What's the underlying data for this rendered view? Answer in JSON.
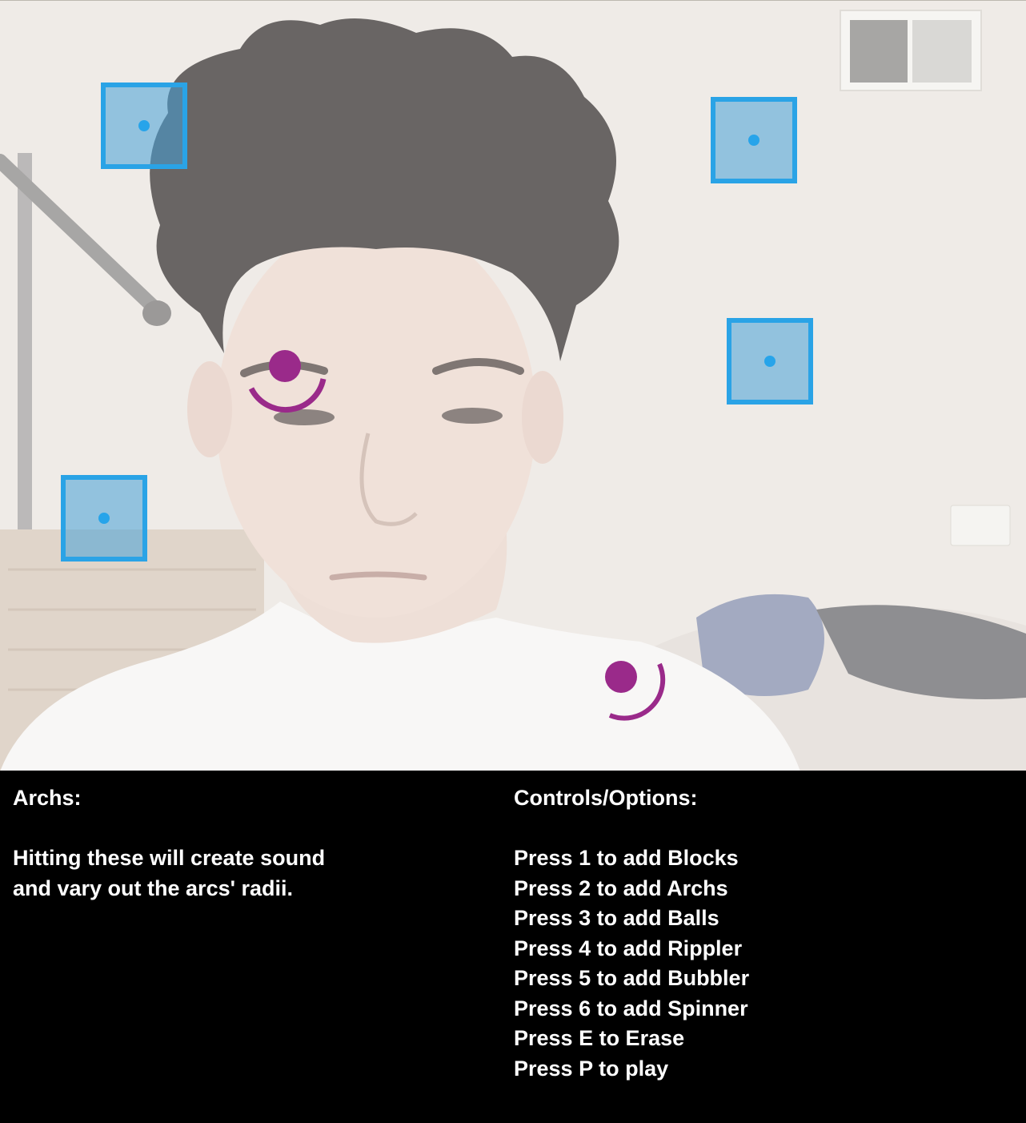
{
  "colors": {
    "block_border": "#2aa3e6",
    "block_fill": "#46a0d7",
    "arch_color": "#9a2a8a",
    "panel_background": "#000000",
    "panel_text": "#ffffff"
  },
  "scene": {
    "blocks": [
      {
        "name": "block-1"
      },
      {
        "name": "block-2"
      },
      {
        "name": "block-3"
      },
      {
        "name": "block-4"
      }
    ],
    "archs": [
      {
        "name": "arch-1"
      },
      {
        "name": "arch-2"
      }
    ]
  },
  "info": {
    "title": "Archs:",
    "description_lines": [
      "Hitting these will create sound",
      "and vary out the arcs' radii."
    ]
  },
  "controls": {
    "title": "Controls/Options:",
    "items": [
      "Press 1 to add Blocks",
      "Press 2 to add Archs",
      "Press 3 to add Balls",
      "Press 4 to add Rippler",
      "Press 5 to add Bubbler",
      "Press 6 to add Spinner",
      "Press E to Erase",
      "Press P to play"
    ]
  }
}
